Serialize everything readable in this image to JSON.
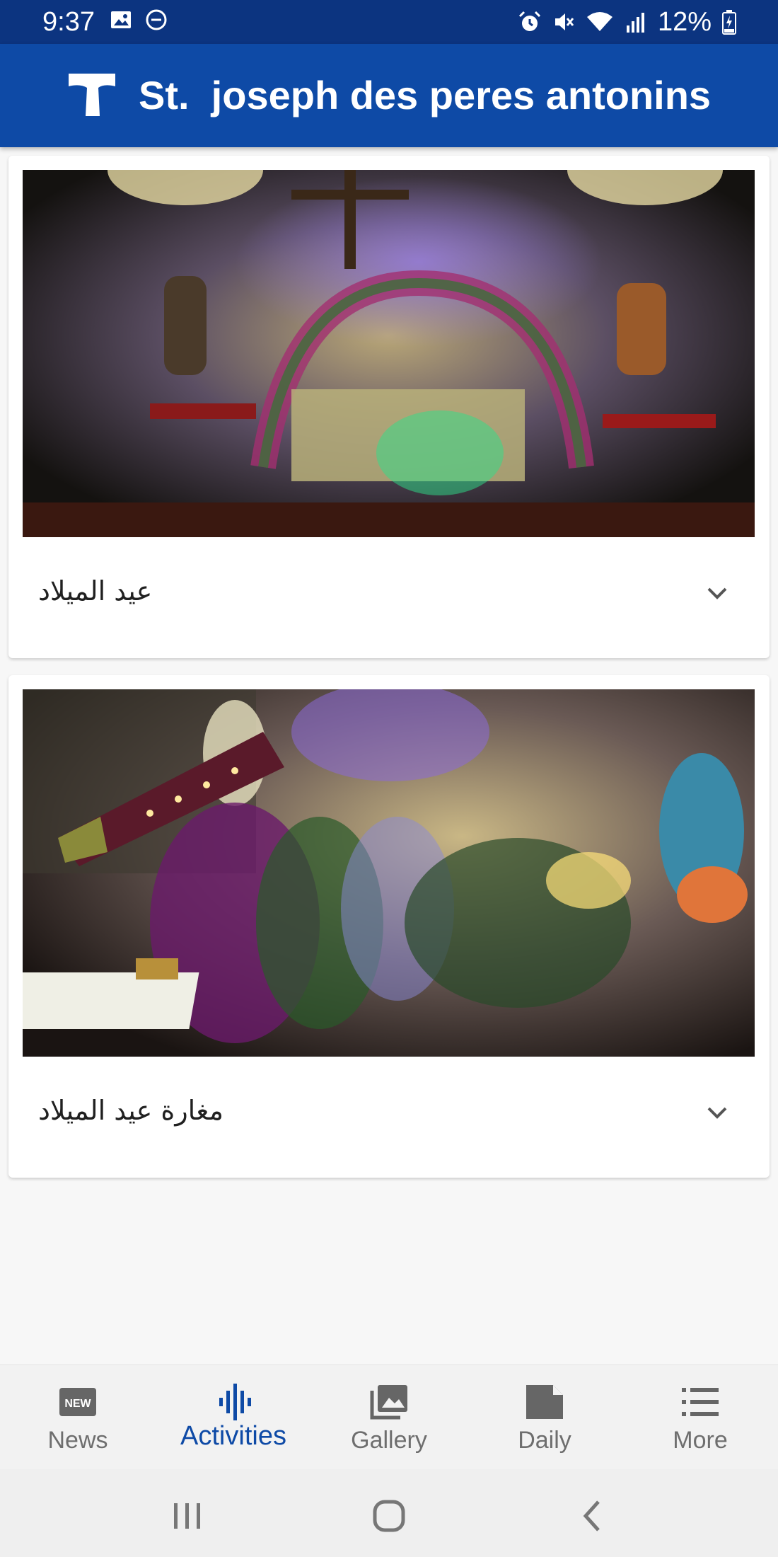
{
  "status_bar": {
    "time": "9:37",
    "battery": "12%",
    "icons": [
      "image-icon",
      "dnd-icon",
      "alarm-icon",
      "mute-icon",
      "wifi-icon",
      "signal-icon",
      "battery-icon"
    ]
  },
  "app_bar": {
    "title": "St.  joseph des peres antonins",
    "logo": "tau-cross-logo",
    "color": "#0e4aa6"
  },
  "cards": [
    {
      "caption": "عيد الميلاد",
      "image": "church altar with nativity decorations",
      "icon": "chevron-down-icon"
    },
    {
      "caption": "مغارة عيد الميلاد",
      "image": "nativity grotto with flowers and stars",
      "icon": "chevron-down-icon"
    }
  ],
  "bottom_nav": {
    "items": [
      {
        "label": "News",
        "icon": "news-icon",
        "active": false
      },
      {
        "label": "Activities",
        "icon": "activities-icon",
        "active": true
      },
      {
        "label": "Gallery",
        "icon": "gallery-icon",
        "active": false
      },
      {
        "label": "Daily",
        "icon": "daily-icon",
        "active": false
      },
      {
        "label": "More",
        "icon": "list-icon",
        "active": false
      }
    ],
    "active_color": "#0e4aa6"
  },
  "system_nav": [
    "recent-apps-icon",
    "home-icon",
    "back-icon"
  ]
}
